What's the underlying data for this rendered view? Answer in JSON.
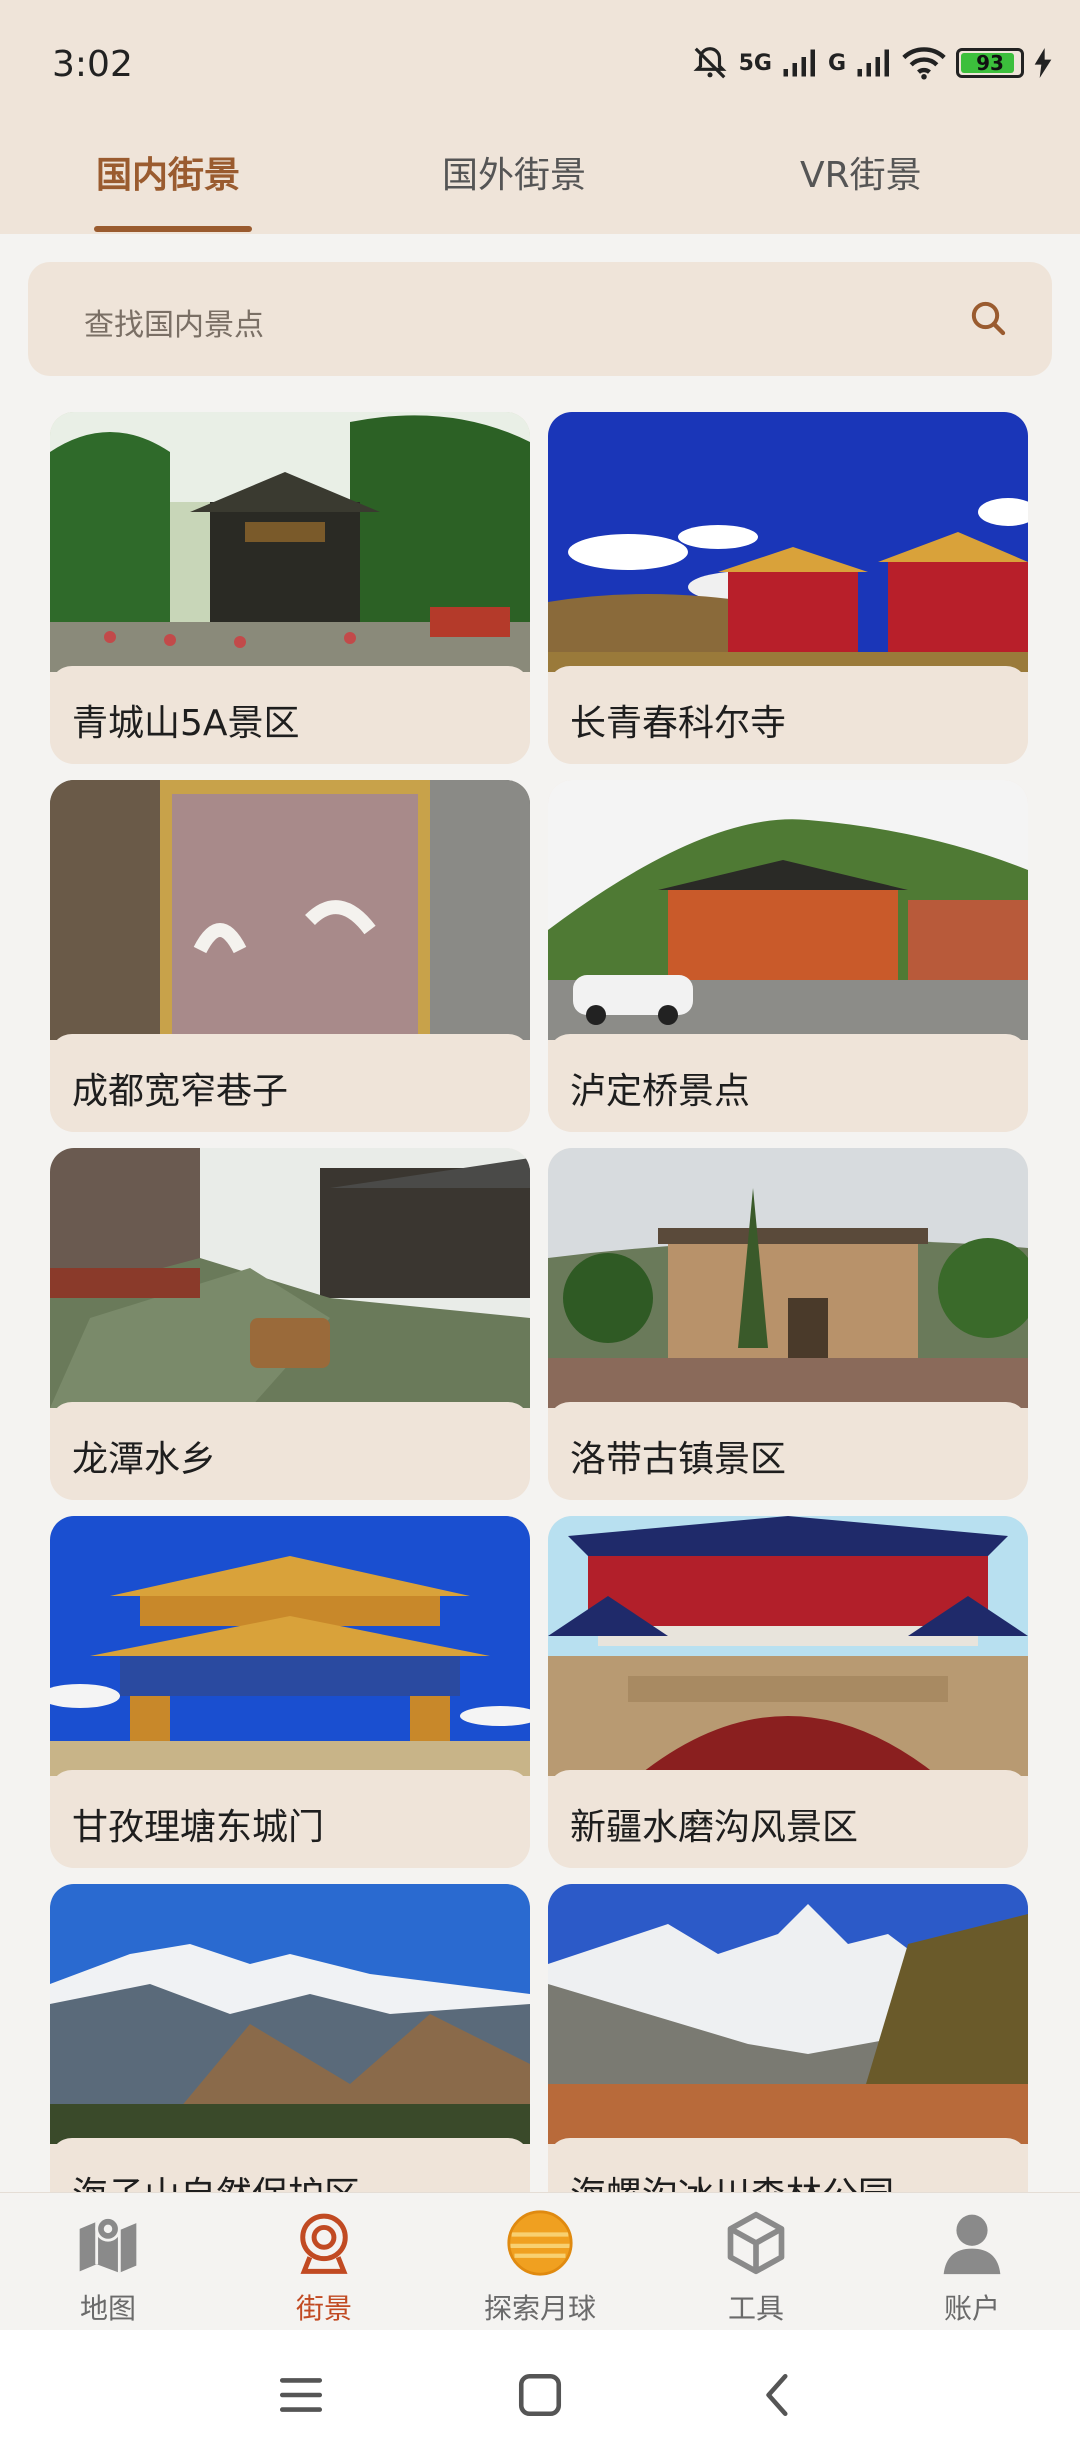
{
  "status": {
    "time": "3:02",
    "signal1": "5G",
    "signal2": "G",
    "battery": "93"
  },
  "tabs": [
    {
      "label": "国内街景",
      "active": true
    },
    {
      "label": "国外街景",
      "active": false
    },
    {
      "label": "VR街景",
      "active": false
    }
  ],
  "search": {
    "placeholder": "查找国内景点"
  },
  "cards": [
    {
      "title": "青城山5A景区"
    },
    {
      "title": "长青春科尔寺"
    },
    {
      "title": "成都宽窄巷子"
    },
    {
      "title": "泸定桥景点"
    },
    {
      "title": "龙潭水乡"
    },
    {
      "title": "洛带古镇景区"
    },
    {
      "title": "甘孜理塘东城门"
    },
    {
      "title": "新疆水磨沟风景区"
    },
    {
      "title": "海子山自然保护区"
    },
    {
      "title": "海螺沟冰川森林公园"
    }
  ],
  "bottom_nav": [
    {
      "label": "地图",
      "icon": "map-icon"
    },
    {
      "label": "街景",
      "icon": "streetview-camera-icon",
      "active": true
    },
    {
      "label": "探索月球",
      "icon": "moon-icon"
    },
    {
      "label": "工具",
      "icon": "cube-icon"
    },
    {
      "label": "账户",
      "icon": "user-icon"
    }
  ],
  "colors": {
    "accent": "#9a5b2f",
    "active_nav": "#c14a22",
    "card_bg": "#efe4d9"
  }
}
